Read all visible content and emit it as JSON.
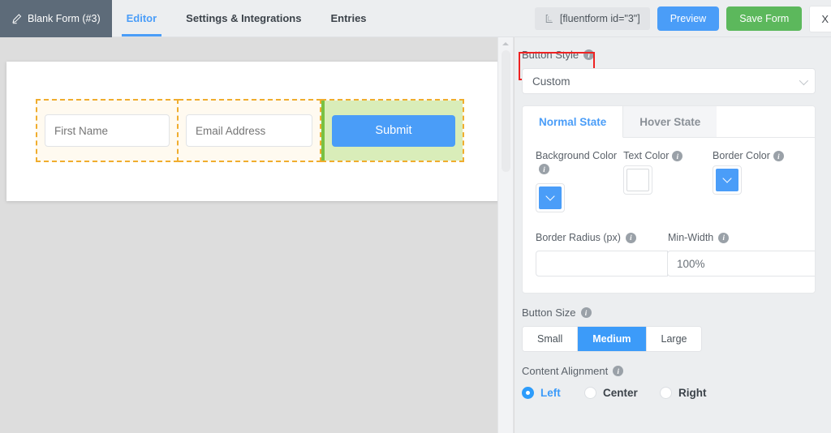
{
  "topbar": {
    "form_title": "Blank Form (#3)",
    "pencil_icon": "pencil-icon",
    "tabs": [
      {
        "label": "Editor",
        "active": true
      },
      {
        "label": "Settings & Integrations",
        "active": false
      },
      {
        "label": "Entries",
        "active": false
      }
    ],
    "shortcode": "[fluentform id=\"3\"]",
    "shortcode_icon": "shortcode-bracket-icon",
    "preview_label": "Preview",
    "save_label": "Save Form",
    "close_label": "X",
    "preview_color": "#4a9df8",
    "save_color": "#5cb85c",
    "title_bg": "#5d6b79"
  },
  "canvas": {
    "columns": [
      {
        "placeholder": "First Name",
        "type": "input"
      },
      {
        "placeholder": "Email Address",
        "type": "input"
      },
      {
        "label": "Submit",
        "type": "button",
        "selected": true
      }
    ],
    "selection_color": "#79c143",
    "selection_bg": "#d9edb9",
    "column_outline_color": "#f0ad2e",
    "submit_button_color": "#4a9df8"
  },
  "panel": {
    "button_style": {
      "label": "Button Style",
      "info_icon": "info-icon",
      "highlighted": true,
      "highlight_color": "#ee2222",
      "selected_option": "Custom",
      "chevron_icon": "chevron-down-icon"
    },
    "state_tabs": [
      {
        "label": "Normal State",
        "active": true
      },
      {
        "label": "Hover State",
        "active": false
      }
    ],
    "colors": [
      {
        "label": "Background Color",
        "swatch": "#4a9df8",
        "kind": "blue"
      },
      {
        "label": "Text Color",
        "swatch": "#ffffff",
        "kind": "white"
      },
      {
        "label": "Border Color",
        "swatch": "#4a9df8",
        "kind": "blue"
      }
    ],
    "border_radius": {
      "label": "Border Radius (px)",
      "value": ""
    },
    "min_width": {
      "label": "Min-Width",
      "value": "100%"
    },
    "button_size": {
      "label": "Button Size",
      "options": [
        {
          "label": "Small",
          "active": false
        },
        {
          "label": "Medium",
          "active": true
        },
        {
          "label": "Large",
          "active": false
        }
      ]
    },
    "content_alignment": {
      "label": "Content Alignment",
      "options": [
        {
          "label": "Left",
          "selected": true
        },
        {
          "label": "Center",
          "selected": false
        },
        {
          "label": "Right",
          "selected": false
        }
      ]
    }
  }
}
